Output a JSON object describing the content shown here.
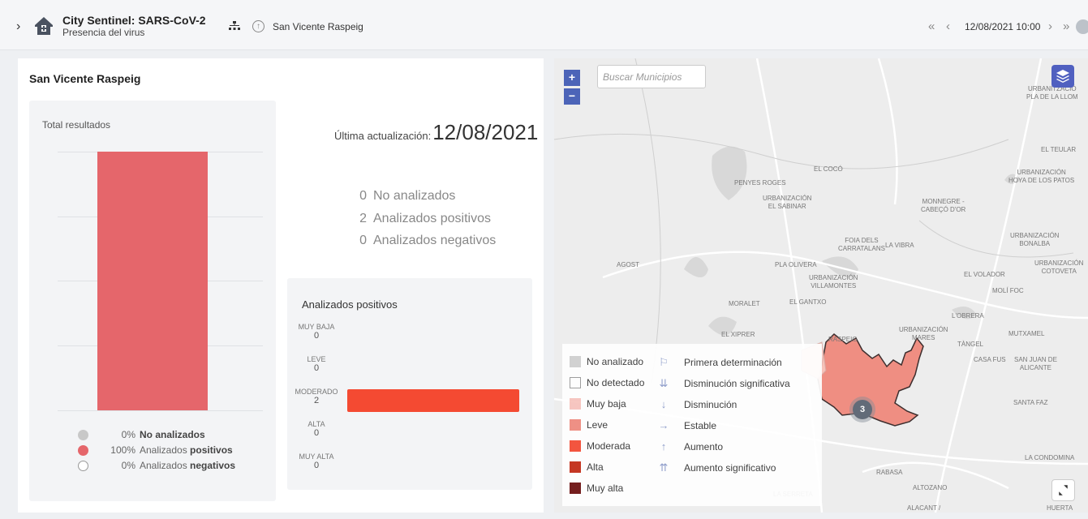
{
  "header": {
    "title": "City Sentinel: SARS-CoV-2",
    "subtitle": "Presencia del virus",
    "location": "San Vicente Raspeig",
    "datetime": "12/08/2021 10:00"
  },
  "panel": {
    "title": "San Vicente Raspeig",
    "total_card": {
      "title": "Total resultados",
      "legend": [
        {
          "pct": "0%",
          "label": "No analizados",
          "prefix": "",
          "bold": "No analizados",
          "color": "#c8c8c8"
        },
        {
          "pct": "100%",
          "prefix": "Analizados ",
          "bold": "positivos",
          "color": "#e5666b"
        },
        {
          "pct": "0%",
          "prefix": "Analizados ",
          "bold": "negativos",
          "color": "#ffffff"
        }
      ]
    },
    "update": {
      "label": "Última actualización:",
      "date": "12/08/2021"
    },
    "summary": [
      {
        "num": "0",
        "label": "No analizados"
      },
      {
        "num": "2",
        "label": "Analizados positivos"
      },
      {
        "num": "0",
        "label": "Analizados negativos"
      }
    ],
    "positives_card": {
      "title": "Analizados positivos",
      "categories": [
        {
          "label": "MUY BAJA",
          "value": "0"
        },
        {
          "label": "LEVE",
          "value": "0"
        },
        {
          "label": "MODERADO",
          "value": "2"
        },
        {
          "label": "ALTA",
          "value": "0"
        },
        {
          "label": "MUY ALTA",
          "value": "0"
        }
      ]
    }
  },
  "chart_data": [
    {
      "type": "bar",
      "title": "Total resultados",
      "categories": [
        "No analizados",
        "Analizados positivos",
        "Analizados negativos"
      ],
      "values": [
        0,
        100,
        0
      ],
      "ylim": [
        0,
        100
      ],
      "unit": "%"
    },
    {
      "type": "bar",
      "orientation": "horizontal",
      "title": "Analizados positivos",
      "categories": [
        "MUY BAJA",
        "LEVE",
        "MODERADO",
        "ALTA",
        "MUY ALTA"
      ],
      "values": [
        0,
        0,
        2,
        0,
        0
      ],
      "max": 2
    }
  ],
  "map": {
    "search_placeholder": "Buscar Municipios",
    "zoom_in": "+",
    "zoom_out": "−",
    "cluster_count": "3",
    "legend_levels": [
      {
        "label": "No analizado",
        "color": "#cfcfcf"
      },
      {
        "label": "No detectado",
        "color": "#ffffff"
      },
      {
        "label": "Muy baja",
        "color": "#f7c3bd"
      },
      {
        "label": "Leve",
        "color": "#ef8a7e"
      },
      {
        "label": "Moderada",
        "color": "#f44a32"
      },
      {
        "label": "Alta",
        "color": "#c22a14"
      },
      {
        "label": "Muy alta",
        "color": "#6b0f0f"
      }
    ],
    "legend_trends": [
      {
        "icon": "⚐",
        "label": "Primera determinación"
      },
      {
        "icon": "⇊",
        "label": "Disminución significativa"
      },
      {
        "icon": "↓",
        "label": "Disminución"
      },
      {
        "icon": "→",
        "label": "Estable"
      },
      {
        "icon": "↑",
        "label": "Aumento"
      },
      {
        "icon": "⇈",
        "label": "Aumento significativo"
      }
    ],
    "places": [
      "URBANITZACIÓ PLA DE LA LLOM",
      "EL TEULAR",
      "URBANIZACIÓN HOYA DE LOS PATOS",
      "EL COCÓ",
      "PENYES ROGES",
      "URBANIZACIÓN EL SABINAR",
      "MONNEGRE - CABEÇÓ D'OR",
      "FOIA DELS CARRATALANS",
      "LA VIBRA",
      "URBANIZACIÓN BONALBA",
      "URBANIZACIÓN COTOVETA",
      "AGOST",
      "PLA OLIVERA",
      "URBANIZACIÓN VILLAMONTES",
      "EL VOLADOR",
      "MOLÍ FOC",
      "MORALET",
      "EL GANTXO",
      "L'OBRERA",
      "EL XIPRER",
      "RASPEIG",
      "URBANIZACIÓN ... MARES",
      "TÀNGEL",
      "MUTXAMEL",
      "CASA FUS",
      "SAN JUAN DE ALICANTE",
      "SANTA FAZ",
      "RABASA",
      "ALTOZANO",
      "LA CONDOMINA",
      "LA SERRETA",
      "ALACANT /",
      "HUERTA"
    ]
  },
  "colors": {
    "accent": "#4c64b8",
    "positive": "#e5666b",
    "moderate": "#f44a32"
  }
}
